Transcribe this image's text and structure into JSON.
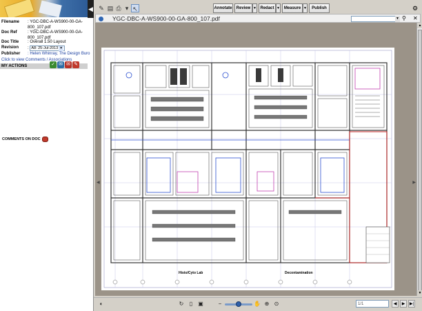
{
  "left_panel": {
    "fields": [
      {
        "key": "Filename",
        "value": "YGC-DBC-A-WS900-00-GA-800_107.pdf"
      },
      {
        "key": "Doc Ref",
        "value": "YGC-DBC-A-WS900-00-GA-800_107.pdf"
      },
      {
        "key": "Doc Title",
        "value": "Overall 1.50 Layout"
      },
      {
        "key": "Revision",
        "value": "A8: 25-Jul-2013"
      },
      {
        "key": "Publisher",
        "value": "Helen Whinray, The Design Buro"
      }
    ],
    "view_comments_link": "Click to view Comments / Associations",
    "my_actions_label": "MY ACTIONS",
    "comments_on_doc_label": "COMMENTS ON DOC",
    "action_icons": [
      "check-icon",
      "envelope-icon",
      "mail-icon",
      "pencil-icon"
    ]
  },
  "toolbar": {
    "annotate_label": "Annotate",
    "review_label": "Review",
    "redact_label": "Redact",
    "measure_label": "Measure",
    "publish_label": "Publish"
  },
  "document": {
    "filename": "YGC-DBC-A-WS900-00-GA-800_107.pdf",
    "find_placeholder": ""
  },
  "drawing": {
    "label_left": "Histo/Cyto Lab",
    "label_right": "Decontamination"
  },
  "bottom_bar": {
    "page_indicator": "1/1",
    "zoom_level_fraction": 0.5
  },
  "colors": {
    "link": "#1b3fa0",
    "canvas_background": "#9b9388",
    "toolbar_background": "#d4d0c8"
  }
}
